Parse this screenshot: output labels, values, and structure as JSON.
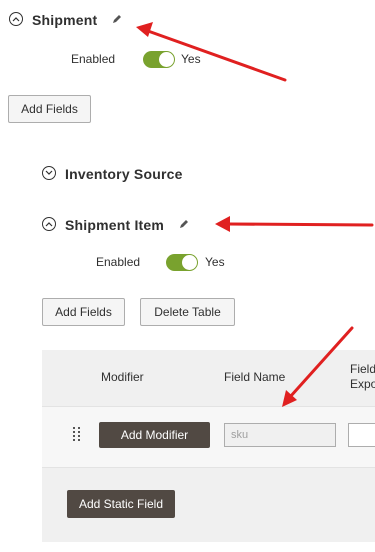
{
  "shipment": {
    "title": "Shipment",
    "enabled_label": "Enabled",
    "toggle_value": "Yes",
    "add_fields": "Add Fields"
  },
  "inventory_source": {
    "title": "Inventory Source"
  },
  "shipment_item": {
    "title": "Shipment Item",
    "enabled_label": "Enabled",
    "toggle_value": "Yes",
    "add_fields": "Add Fields",
    "delete_table": "Delete Table"
  },
  "table": {
    "headers": {
      "modifier": "Modifier",
      "field_name": "Field Name",
      "field_export_line1": "Field",
      "field_export_line2": "Expo"
    },
    "row": {
      "add_modifier": "Add Modifier",
      "field_name_value": "sku"
    },
    "add_static_field": "Add Static Field"
  },
  "colors": {
    "toggle_on": "#79a22e",
    "dark_button": "#514943",
    "annotation_arrow": "#e02020"
  }
}
